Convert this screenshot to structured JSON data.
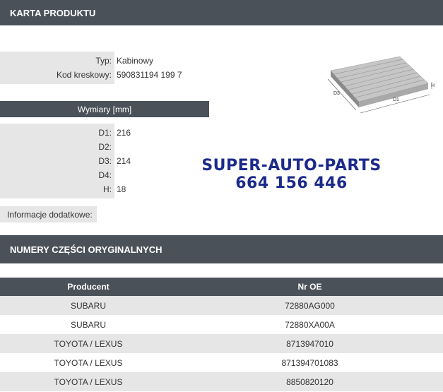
{
  "card_header": "KARTA PRODUKTU",
  "basic": {
    "type_label": "Typ:",
    "type_value": "Kabinowy",
    "barcode_label": "Kod kreskowy:",
    "barcode_value": "590831194 199 7"
  },
  "dimensions": {
    "header": "Wymiary [mm]",
    "rows": [
      {
        "label": "D1:",
        "value": "216"
      },
      {
        "label": "D2:",
        "value": ""
      },
      {
        "label": "D3:",
        "value": "214"
      },
      {
        "label": "D4:",
        "value": ""
      },
      {
        "label": "H:",
        "value": "18"
      }
    ]
  },
  "info_label": "Informacje dodatkowe:",
  "watermark": {
    "line1": "SUPER-AUTO-PARTS",
    "line2": "664 156 446"
  },
  "diagram_labels": {
    "d3": "D3",
    "d1": "D1",
    "h": "H"
  },
  "oe_header": "NUMERY CZĘŚCI ORYGINALNYCH",
  "oe_table": {
    "columns": [
      "Producent",
      "Nr OE"
    ],
    "rows": [
      [
        "SUBARU",
        "72880AG000"
      ],
      [
        "SUBARU",
        "72880XA00A"
      ],
      [
        "TOYOTA / LEXUS",
        "8713947010"
      ],
      [
        "TOYOTA / LEXUS",
        "871394701083"
      ],
      [
        "TOYOTA / LEXUS",
        "8850820120"
      ]
    ]
  },
  "colors": {
    "header_bg": "#4a5159",
    "label_bg": "#e6e6e6",
    "watermark": "#1c2a8a"
  }
}
